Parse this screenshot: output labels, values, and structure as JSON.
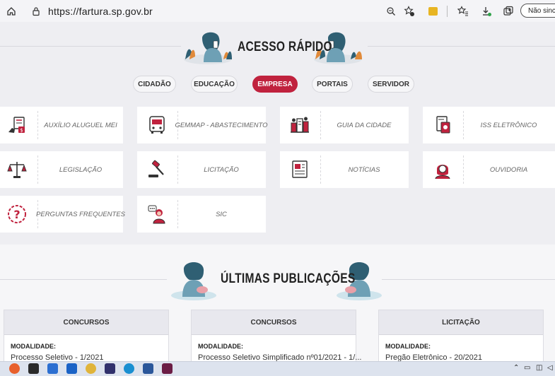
{
  "browser": {
    "url": "https://fartura.sp.gov.br",
    "sync_label": "Não sincr",
    "icons": [
      "home-icon",
      "lock-icon",
      "zoom-icon",
      "favorite-add-icon",
      "extension-icon",
      "favorites-icon",
      "downloads-icon",
      "collections-icon"
    ]
  },
  "quick_access": {
    "title": "ACESSO RÁPIDO",
    "tabs": [
      {
        "label": "CIDADÃO"
      },
      {
        "label": "EDUCAÇÃO"
      },
      {
        "label": "EMPRESA",
        "active": true
      },
      {
        "label": "PORTAIS"
      },
      {
        "label": "SERVIDOR"
      }
    ],
    "cards": [
      {
        "label": "AUXÍLIO ALUGUEL MEI",
        "icon": "rent-aid-icon"
      },
      {
        "label": "GEMMAP - ABASTECIMENTO",
        "icon": "bus-icon"
      },
      {
        "label": "GUIA DA CIDADE",
        "icon": "city-guide-icon"
      },
      {
        "label": "ISS ELETRÔNICO",
        "icon": "iss-document-icon"
      },
      {
        "label": "LEGISLAÇÃO",
        "icon": "scales-icon"
      },
      {
        "label": "LICITAÇÃO",
        "icon": "gavel-icon"
      },
      {
        "label": "NOTÍCIAS",
        "icon": "newspaper-icon"
      },
      {
        "label": "OUVIDORIA",
        "icon": "headset-operator-icon"
      },
      {
        "label": "PERGUNTAS FREQUENTES",
        "icon": "question-icon"
      },
      {
        "label": "SIC",
        "icon": "information-desk-icon"
      }
    ]
  },
  "publications": {
    "title": "ÚLTIMAS PUBLICAÇÕES",
    "items": [
      {
        "category": "CONCURSOS",
        "mod_label": "MODALIDADE:",
        "value": "Processo Seletivo - 1/2021"
      },
      {
        "category": "CONCURSOS",
        "mod_label": "MODALIDADE:",
        "value": "Processo Seletivo Simplificado nº01/2021 - 1/..."
      },
      {
        "category": "LICITAÇÃO",
        "mod_label": "MODALIDADE:",
        "value": "Pregão Eletrônico - 20/2021"
      }
    ]
  },
  "colors": {
    "accent": "#c0223e",
    "background": "#eeeef2",
    "card": "#ffffff",
    "illustration_teal": "#2f5f73",
    "illustration_orange": "#e08a3a"
  }
}
